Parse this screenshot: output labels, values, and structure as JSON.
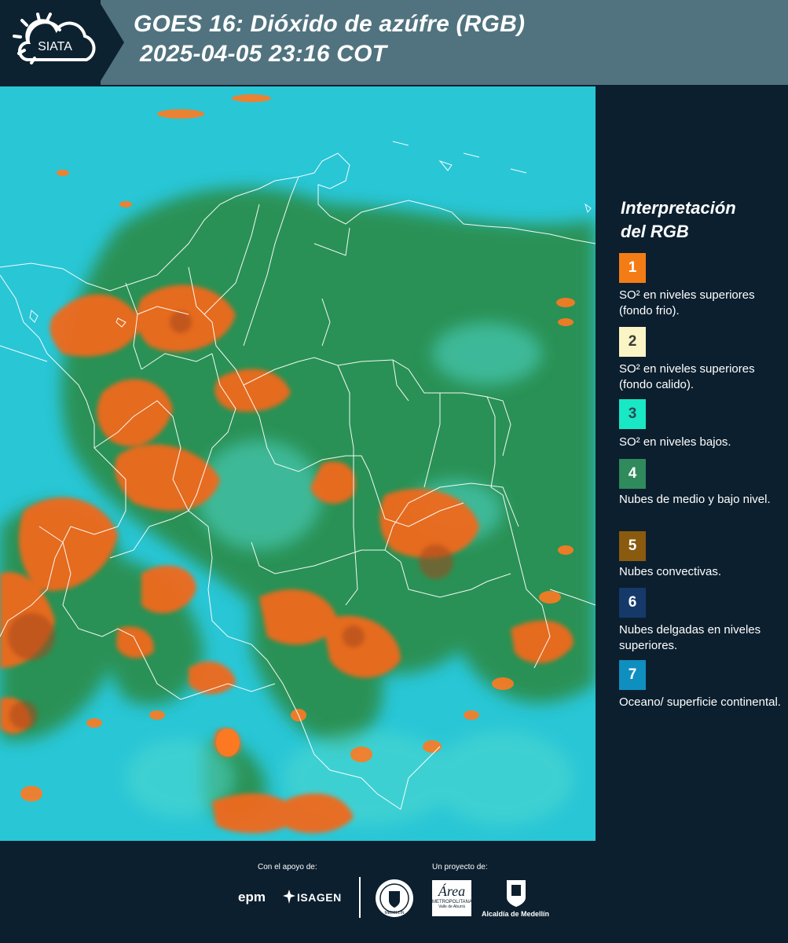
{
  "header": {
    "logo_text": "SIATA",
    "title_line1": "GOES 16: Dióxido de azúfre (RGB)",
    "title_line2": "2025-04-05 23:16 COT"
  },
  "legend": {
    "title_line1": "Interpretación",
    "title_line2": "del RGB",
    "items": [
      {
        "num": "1",
        "color": "#f47c16",
        "num_color": "#ffffff",
        "label": "SO² en niveles superiores (fondo frio)."
      },
      {
        "num": "2",
        "color": "#fbf5c5",
        "num_color": "#3a3a3a",
        "label": "SO² en niveles superiores (fondo calido)."
      },
      {
        "num": "3",
        "color": "#19e8c4",
        "num_color": "#2c4a54",
        "label": "SO² en niveles bajos."
      },
      {
        "num": "4",
        "color": "#2f8a5c",
        "num_color": "#ffffff",
        "label": "Nubes de medio y bajo nivel."
      },
      {
        "num": "5",
        "color": "#8a5a0f",
        "num_color": "#ffffff",
        "label": "Nubes convectivas."
      },
      {
        "num": "6",
        "color": "#153a6a",
        "num_color": "#ffffff",
        "label": "Nubes delgadas en niveles superiores."
      },
      {
        "num": "7",
        "color": "#0f8fbf",
        "num_color": "#ffffff",
        "label": "Oceano/ superficie continental."
      }
    ]
  },
  "footer": {
    "support_label": "Con el apoyo de:",
    "project_label": "Un proyecto de:",
    "epm": "epm",
    "isagen": "ISAGEN",
    "area_word": "Área",
    "area_sub1": "METROPOLITANA",
    "area_sub2": "Valle de Aburrá",
    "alcaldia": "Alcaldía de Medellín",
    "seal_text": "MEDELLÍN"
  },
  "colors": {
    "ocean": "#29c6d6",
    "cloud_green": "#2b8f4f",
    "convective_orange": "#f0691a",
    "borders": "#ffffff",
    "header_band": "#50737f",
    "dark_bg": "#0c1f2e"
  }
}
